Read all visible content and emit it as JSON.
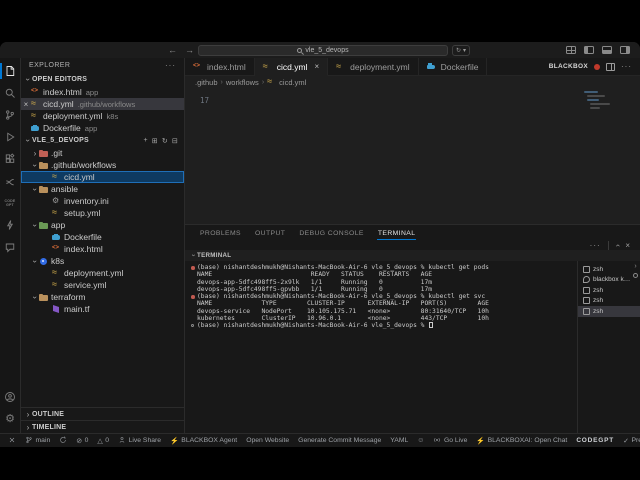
{
  "titlebar": {
    "search_value": "vle_5_devops",
    "back_icon": "←",
    "forward_icon": "→"
  },
  "activity_bar": {
    "items": [
      {
        "name": "explorer-icon",
        "active": true
      },
      {
        "name": "search-icon"
      },
      {
        "name": "source-control-icon"
      },
      {
        "name": "run-debug-icon"
      },
      {
        "name": "extensions-icon"
      },
      {
        "name": "live-share-icon"
      },
      {
        "name": "codegpt-icon",
        "text": "CODE GPT"
      },
      {
        "name": "blackbox-icon"
      },
      {
        "name": "chat-icon"
      },
      {
        "name": "account-icon"
      },
      {
        "name": "settings-gear-icon"
      }
    ]
  },
  "sidebar": {
    "title": "EXPLORER",
    "open_editors": {
      "label": "OPEN EDITORS",
      "items": [
        {
          "name": "index.html",
          "detail": "app",
          "icon": "html"
        },
        {
          "name": "cicd.yml",
          "detail": ".github/workflows",
          "icon": "yaml",
          "selected": true,
          "closable": true
        },
        {
          "name": "deployment.yml",
          "detail": "k8s",
          "icon": "yaml"
        },
        {
          "name": "Dockerfile",
          "detail": "app",
          "icon": "docker"
        }
      ]
    },
    "project": {
      "label": "VLE_5_DEVOPS",
      "actions": [
        "new-file-icon",
        "new-folder-icon",
        "refresh-icon",
        "collapse-all-icon"
      ],
      "tree": [
        {
          "label": ".git",
          "icon": "git",
          "depth": 0,
          "expandable": true,
          "expanded": false
        },
        {
          "label": ".github/workflows",
          "icon": "folder",
          "depth": 0,
          "expandable": true,
          "expanded": true
        },
        {
          "label": "cicd.yml",
          "icon": "yaml",
          "depth": 1,
          "selected": true
        },
        {
          "label": "ansible",
          "icon": "folder",
          "depth": 0,
          "expandable": true,
          "expanded": true
        },
        {
          "label": "inventory.ini",
          "icon": "ini",
          "depth": 1
        },
        {
          "label": "setup.yml",
          "icon": "yaml",
          "depth": 1
        },
        {
          "label": "app",
          "icon": "app",
          "depth": 0,
          "expandable": true,
          "expanded": true
        },
        {
          "label": "Dockerfile",
          "icon": "docker",
          "depth": 1
        },
        {
          "label": "index.html",
          "icon": "html",
          "depth": 1
        },
        {
          "label": "k8s",
          "icon": "k8s",
          "depth": 0,
          "expandable": true,
          "expanded": true
        },
        {
          "label": "deployment.yml",
          "icon": "yaml",
          "depth": 1
        },
        {
          "label": "service.yml",
          "icon": "yaml",
          "depth": 1
        },
        {
          "label": "terraform",
          "icon": "folder",
          "depth": 0,
          "expandable": true,
          "expanded": true
        },
        {
          "label": "main.tf",
          "icon": "tf",
          "depth": 1
        }
      ]
    },
    "outline_label": "OUTLINE",
    "timeline_label": "TIMELINE"
  },
  "editor": {
    "tabs": [
      {
        "label": "index.html",
        "icon": "html"
      },
      {
        "label": "cicd.yml",
        "icon": "yaml",
        "active": true,
        "closable": true
      },
      {
        "label": "deployment.yml",
        "icon": "yaml"
      },
      {
        "label": "Dockerfile",
        "icon": "docker"
      }
    ],
    "actions": {
      "blackbox_label": "BLACKBOX"
    },
    "breadcrumb": [
      ".github",
      "workflows",
      "cicd.yml"
    ],
    "visible_line_number": "17"
  },
  "panel": {
    "tabs": [
      "PROBLEMS",
      "OUTPUT",
      "DEBUG CONSOLE",
      "TERMINAL"
    ],
    "active_tab": "TERMINAL",
    "section_label": "TERMINAL",
    "terminal_lines": [
      {
        "decoration": "filled",
        "text": "(base) nishantdeshmukh@Nishants-MacBook-Air-6 vle_5_devops % kubectl get pods"
      },
      {
        "decoration": "none",
        "text": "NAME                          READY   STATUS    RESTARTS   AGE"
      },
      {
        "decoration": "none",
        "text": "devops-app-5dfc498ff5-2x9lk   1/1     Running   0          17m"
      },
      {
        "decoration": "none",
        "text": "devops-app-5dfc498ff5-gpvbb   1/1     Running   0          17m"
      },
      {
        "decoration": "filled",
        "text": "(base) nishantdeshmukh@Nishants-MacBook-Air-6 vle_5_devops % kubectl get svc"
      },
      {
        "decoration": "none",
        "text": "NAME             TYPE        CLUSTER-IP      EXTERNAL-IP   PORT(S)        AGE"
      },
      {
        "decoration": "none",
        "text": "devops-service   NodePort    10.105.175.71   <none>        80:31640/TCP   10h"
      },
      {
        "decoration": "none",
        "text": "kubernetes       ClusterIP   10.96.0.1       <none>        443/TCP        10h"
      },
      {
        "decoration": "hollow",
        "text": "(base) nishantdeshmukh@Nishants-MacBook-Air-6 vle_5_devops % ",
        "cursor": true
      }
    ],
    "terminal_list": [
      {
        "label": "zsh",
        "icon": "term"
      },
      {
        "label": "blackbox  k…",
        "icon": "plug"
      },
      {
        "label": "zsh",
        "icon": "term"
      },
      {
        "label": "zsh",
        "icon": "term"
      },
      {
        "label": "zsh",
        "icon": "term",
        "selected": true
      }
    ]
  },
  "status_bar": {
    "items": [
      {
        "icon": "remote-icon",
        "glyph": "✕",
        "label": ""
      },
      {
        "icon": "git-branch-icon",
        "label": "main"
      },
      {
        "icon": "sync-icon",
        "label": ""
      },
      {
        "icon": "errors-icon",
        "glyph": "⊘",
        "label": "0"
      },
      {
        "icon": "warnings-icon",
        "glyph": "△",
        "label": "0"
      },
      {
        "icon": "live-share-icon",
        "label": "Live Share"
      },
      {
        "icon": "lightning-icon",
        "glyph": "⚡",
        "label": "BLACKBOX Agent",
        "bolt": true
      },
      {
        "label": "Open Website"
      },
      {
        "label": "Generate Commit Message"
      },
      {
        "label": "YAML"
      },
      {
        "icon": "feedback-smiley-icon",
        "glyph": "☺",
        "label": ""
      },
      {
        "icon": "go-live-icon",
        "label": "Go Live"
      },
      {
        "icon": "lightning-icon",
        "glyph": "⚡",
        "label": "BLACKBOXAI: Open Chat",
        "bolt": true
      },
      {
        "label": "CODEGPT",
        "logo": true
      },
      {
        "icon": "check-icon",
        "glyph": "✓",
        "label": "Prettier"
      },
      {
        "icon": "bell-icon",
        "label": ""
      }
    ],
    "colors": {
      "accent_blue": "#0078d4",
      "bolt_yellow": "#e8c64d",
      "blackbox_red": "#c0392b"
    }
  }
}
